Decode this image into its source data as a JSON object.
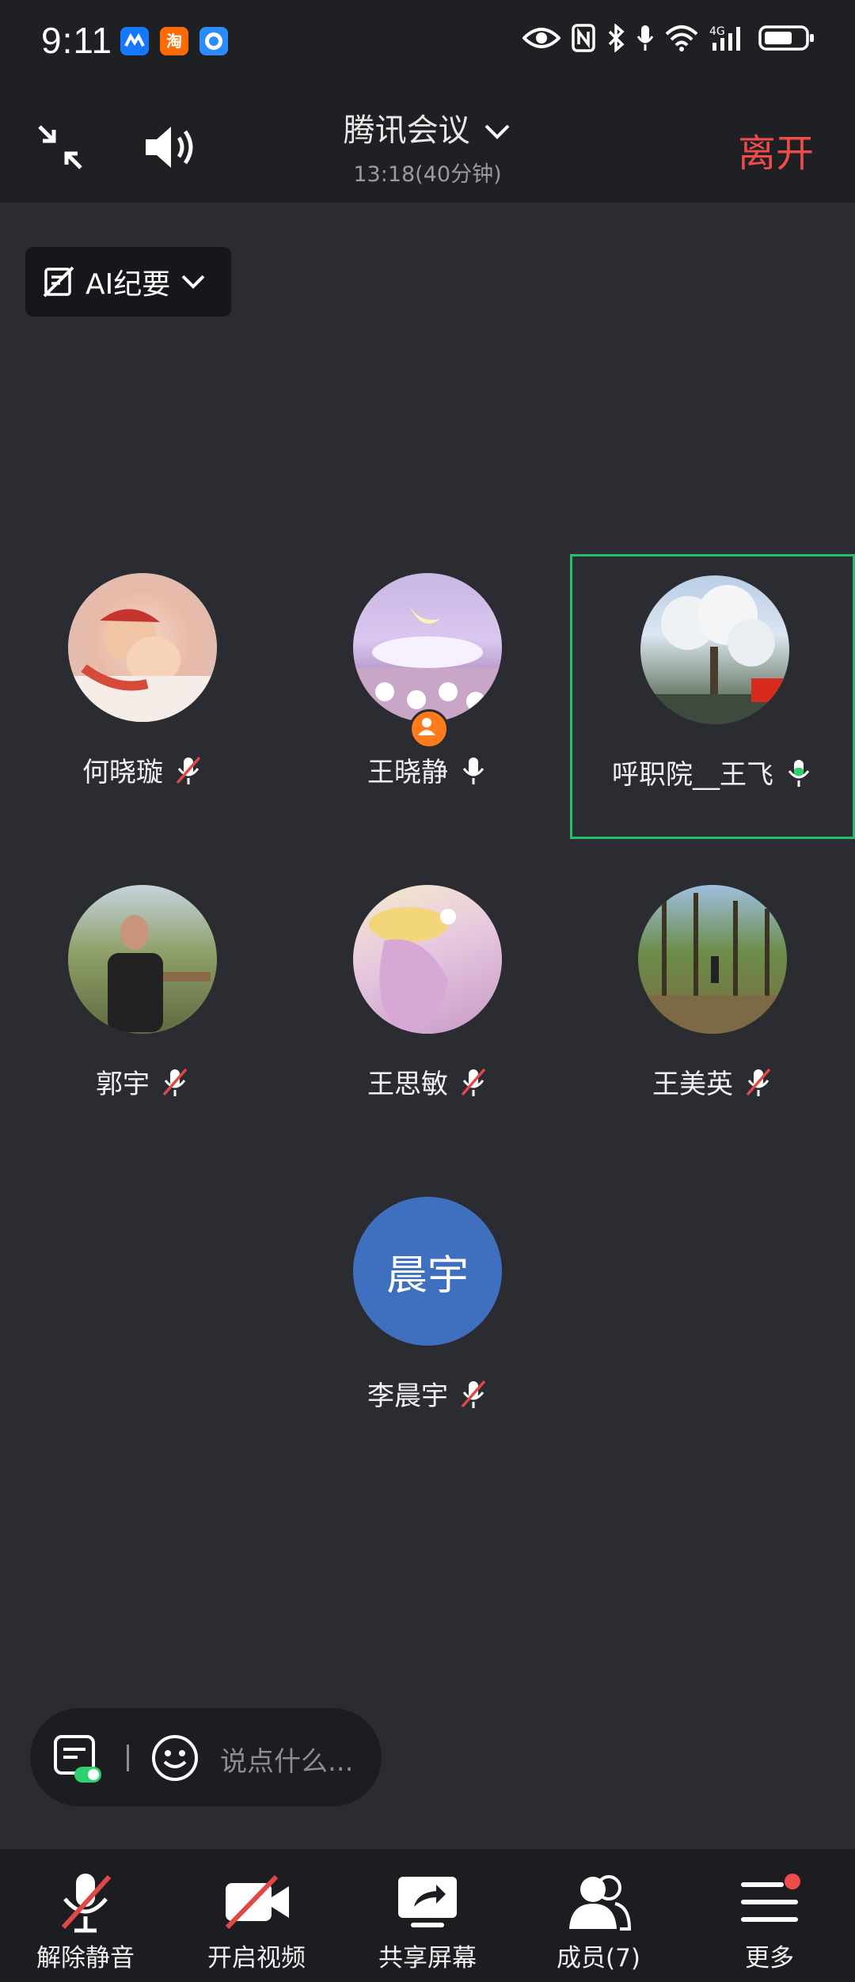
{
  "status_bar": {
    "time": "9:11",
    "network": "4G"
  },
  "header": {
    "title": "腾讯会议",
    "subtitle": "13:18(40分钟)",
    "leave_label": "离开"
  },
  "ai_chip": {
    "label": "AI纪要"
  },
  "participants": [
    {
      "name": "何晓璇",
      "mic": "muted"
    },
    {
      "name": "王晓静",
      "mic": "on",
      "host": true
    },
    {
      "name": "呼职院__王飞",
      "mic": "speaking",
      "active": true
    },
    {
      "name": "郭宇",
      "mic": "muted"
    },
    {
      "name": "王思敏",
      "mic": "muted"
    },
    {
      "name": "王美英",
      "mic": "muted"
    },
    {
      "name": "李晨宇",
      "mic": "muted",
      "avatar_text": "晨宇"
    }
  ],
  "chat": {
    "placeholder": "说点什么..."
  },
  "toolbar": {
    "unmute": "解除静音",
    "video": "开启视频",
    "share": "共享屏幕",
    "members": "成员(7)",
    "more": "更多"
  },
  "colors": {
    "leave": "#f04b4b",
    "active_border": "#1fbf6b",
    "speaking_mic": "#2fd16e",
    "avatar_text_bg": "#3f6fbf"
  }
}
